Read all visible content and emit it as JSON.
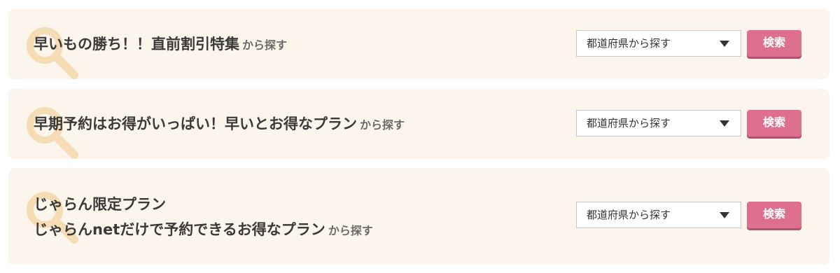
{
  "sections": [
    {
      "title_lines": [
        "早いもの勝ち！！直前割引特集"
      ],
      "suffix": "から探す",
      "select_label": "都道府県から探す",
      "button_label": "検索"
    },
    {
      "title_lines": [
        "早期予約はお得がいっぱい！早いとお得なプラン"
      ],
      "suffix": "から探す",
      "select_label": "都道府県から探す",
      "button_label": "検索"
    },
    {
      "title_lines": [
        "じゃらん限定プラン",
        "じゃらんnetだけで予約できるお得なプラン"
      ],
      "suffix": "から探す",
      "select_label": "都道府県から探す",
      "button_label": "検索"
    }
  ],
  "colors": {
    "panel_bg": "#fcf5eb",
    "magnifier": "#f5dcb4",
    "button": "#df6f8f",
    "button_shadow": "#b84e6d",
    "title_text": "#3a3a3a"
  },
  "icons": {
    "decor": "magnifier-icon",
    "dropdown": "caret-down-icon"
  }
}
